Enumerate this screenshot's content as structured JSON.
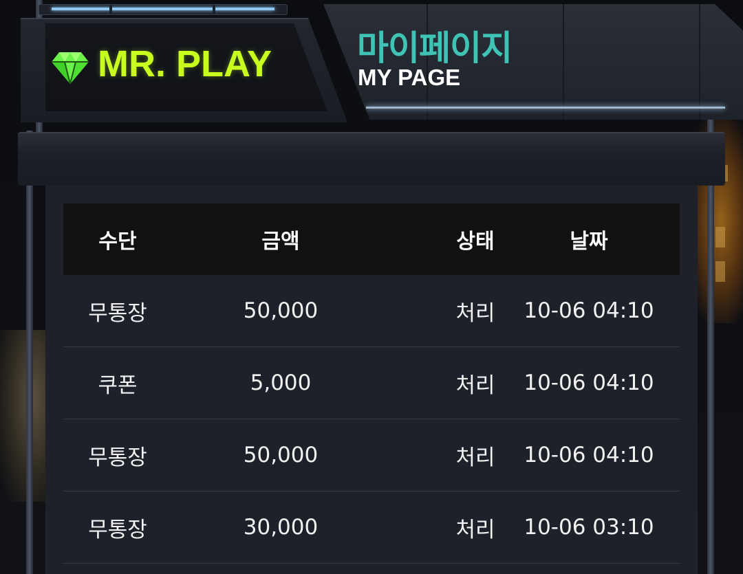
{
  "brand": {
    "logo_text": "MR. PLAY",
    "logo_color": "#c8ff1e",
    "logo_icon": "diamond-icon"
  },
  "page_title": {
    "korean": "마이페이지",
    "english": "MY PAGE",
    "accent_color": "#3fc3b4"
  },
  "table": {
    "headers": [
      "수단",
      "금액",
      "상태",
      "날짜"
    ],
    "rows": [
      {
        "method": "무통장",
        "amount": "50,000",
        "status": "처리",
        "date": "10-06 04:10"
      },
      {
        "method": "쿠폰",
        "amount": "5,000",
        "status": "처리",
        "date": "10-06 04:10"
      },
      {
        "method": "무통장",
        "amount": "50,000",
        "status": "처리",
        "date": "10-06 04:10"
      },
      {
        "method": "무통장",
        "amount": "30,000",
        "status": "처리",
        "date": "10-06 03:10"
      }
    ]
  }
}
